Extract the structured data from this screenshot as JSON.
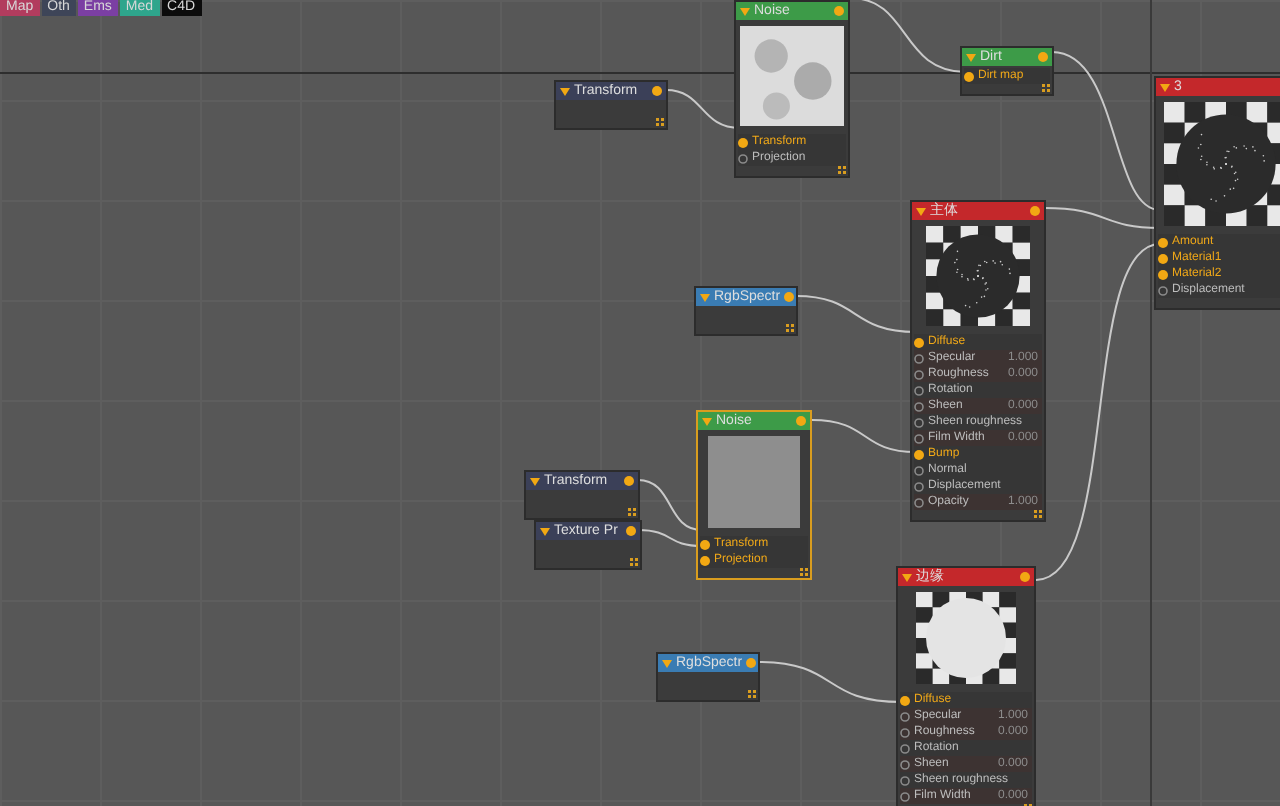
{
  "toolbar_tabs": [
    {
      "label": "Map",
      "color": "#b23c5e"
    },
    {
      "label": "Oth",
      "color": "#3e4558"
    },
    {
      "label": "Ems",
      "color": "#7b3fa3"
    },
    {
      "label": "Med",
      "color": "#2ea58c"
    },
    {
      "label": "C4D",
      "color": "#0c0c0c"
    }
  ],
  "nodes": [
    {
      "title": "Transform",
      "color": "#3b4058",
      "selected": false
    },
    {
      "title": "Noise",
      "color": "#3d9b48",
      "selected": false,
      "preview": {
        "kind": "cloud"
      },
      "inputs": [
        {
          "label": "Transform",
          "connected": true
        },
        {
          "label": "Projection",
          "connected": false
        }
      ]
    },
    {
      "title": "Dirt",
      "color": "#3d9b48",
      "selected": false,
      "inputs": [
        {
          "label": "Dirt map",
          "connected": true
        }
      ]
    },
    {
      "title": "3",
      "color": "#c4282b",
      "selected": false,
      "preview": {
        "kind": "sphere-dark"
      },
      "inputs": [
        {
          "label": "Amount",
          "connected": true
        },
        {
          "label": "Material1",
          "connected": true
        },
        {
          "label": "Material2",
          "connected": true
        },
        {
          "label": "Displacement",
          "connected": false
        }
      ]
    },
    {
      "title": "主体",
      "color": "#c4282b",
      "selected": false,
      "preview": {
        "kind": "sphere-dark"
      },
      "inputs": [
        {
          "label": "Diffuse",
          "connected": true
        },
        {
          "label": "Specular",
          "value": "1.000",
          "connected": false
        },
        {
          "label": "Roughness",
          "value": "0.000",
          "connected": false
        },
        {
          "label": "Rotation",
          "connected": false
        },
        {
          "label": "Sheen",
          "value": "0.000",
          "connected": false
        },
        {
          "label": "Sheen roughness",
          "connected": false
        },
        {
          "label": "Film Width",
          "value": "0.000",
          "connected": false
        },
        {
          "label": "Bump",
          "connected": true
        },
        {
          "label": "Normal",
          "connected": false
        },
        {
          "label": "Displacement",
          "connected": false
        },
        {
          "label": "Opacity",
          "value": "1.000",
          "connected": false
        }
      ]
    },
    {
      "title": "RgbSpectr",
      "color": "#3a7cb3",
      "selected": false
    },
    {
      "title": "Noise",
      "color": "#3d9b48",
      "selected": true,
      "preview": {
        "kind": "grain"
      },
      "inputs": [
        {
          "label": "Transform",
          "connected": true
        },
        {
          "label": "Projection",
          "connected": true
        }
      ]
    },
    {
      "title": "Transform",
      "color": "#3b4058",
      "selected": false
    },
    {
      "title": "Texture Pr",
      "color": "#3b4058",
      "selected": false
    },
    {
      "title": "边缘",
      "color": "#c4282b",
      "selected": false,
      "preview": {
        "kind": "sphere-white"
      },
      "inputs": [
        {
          "label": "Diffuse",
          "connected": true
        },
        {
          "label": "Specular",
          "value": "1.000",
          "connected": false
        },
        {
          "label": "Roughness",
          "value": "0.000",
          "connected": false
        },
        {
          "label": "Rotation",
          "connected": false
        },
        {
          "label": "Sheen",
          "value": "0.000",
          "connected": false
        },
        {
          "label": "Sheen roughness",
          "connected": false
        },
        {
          "label": "Film Width",
          "value": "0.000",
          "connected": false
        }
      ]
    },
    {
      "title": "RgbSpectr",
      "color": "#3a7cb3",
      "selected": false
    }
  ]
}
